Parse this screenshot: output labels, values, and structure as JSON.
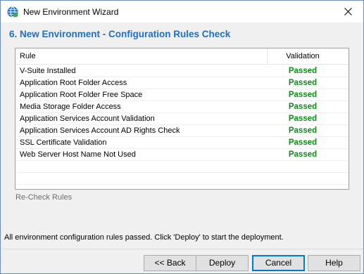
{
  "window": {
    "title": "New Environment Wizard",
    "icon": "globe-icon",
    "close_icon": "close-icon"
  },
  "page": {
    "heading": "6. New Environment - Configuration Rules Check",
    "heading_color": "#1f6fc4"
  },
  "grid": {
    "columns": [
      "Rule",
      "Validation"
    ],
    "rows": [
      {
        "rule": "V-Suite Installed",
        "validation": "Passed"
      },
      {
        "rule": "Application Root Folder Access",
        "validation": "Passed"
      },
      {
        "rule": "Application Root Folder Free Space",
        "validation": "Passed"
      },
      {
        "rule": "Media Storage Folder Access",
        "validation": "Passed"
      },
      {
        "rule": "Application Services Account Validation",
        "validation": "Passed"
      },
      {
        "rule": "Application Services Account AD Rights Check",
        "validation": "Passed"
      },
      {
        "rule": "SSL Certificate Validation",
        "validation": "Passed"
      },
      {
        "rule": "Web Server Host Name Not Used",
        "validation": "Passed"
      }
    ],
    "passed_color": "#0b8a14"
  },
  "recheck_label": "Re-Check Rules",
  "status_message": "All environment configuration rules passed. Click 'Deploy' to start the deployment.",
  "buttons": {
    "back": "<< Back",
    "deploy": "Deploy",
    "cancel": "Cancel",
    "help": "Help"
  }
}
